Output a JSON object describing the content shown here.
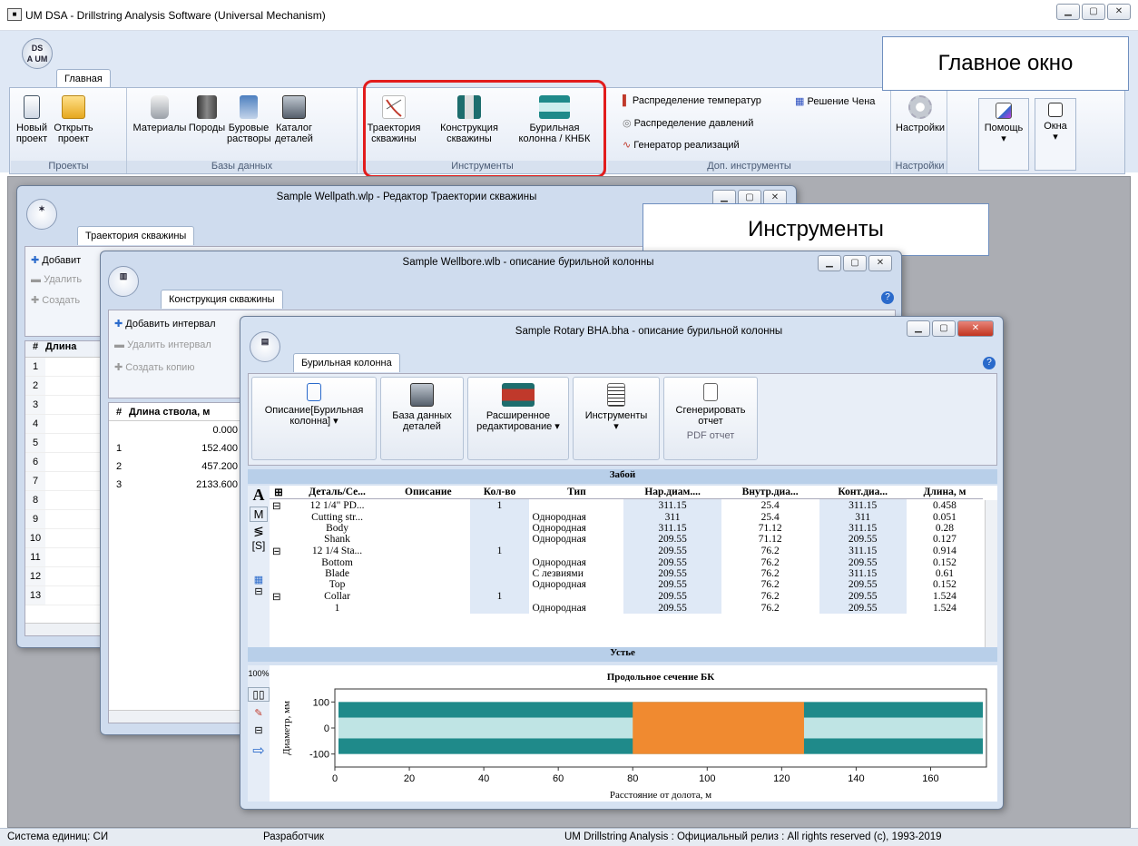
{
  "app": {
    "title": "UM DSA - Drillstring Analysis Software (Universal Mechanism)",
    "logo_text": "DS A UM"
  },
  "ribbon": {
    "tab": "Главная",
    "groups": {
      "projects": {
        "label": "Проекты",
        "new": "Новый проект",
        "open": "Открыть проект"
      },
      "databases": {
        "label": "Базы данных",
        "materials": "Материалы",
        "rocks": "Породы",
        "fluids": "Буровые растворы",
        "catalog": "Каталог деталей"
      },
      "tools": {
        "label": "Инструменты",
        "trajectory": "Траектория скважины",
        "construction": "Конструкция скважины",
        "string": "Бурильная колонна / КНБК"
      },
      "extra": {
        "label": "Доп. инструменты",
        "temp": "Распределение температур",
        "chen": "Решение Чена",
        "pressure": "Распределение давлений",
        "generator": "Генератор реализаций"
      },
      "settings": {
        "label": "Настройки",
        "btn": "Настройки"
      },
      "help": "Помощь",
      "windows": "Окна"
    }
  },
  "callouts": {
    "main": "Главное окно",
    "tools": "Инструменты"
  },
  "w1": {
    "title": "Sample Wellpath.wlp - Редактор Траектории скважины",
    "tab": "Траектория скважины",
    "add": "Добавит",
    "del": "Удалить",
    "create": "Создать",
    "col_num": "#",
    "col_len": "Длина",
    "rows": [
      "1",
      "2",
      "3",
      "4",
      "5",
      "6",
      "7",
      "8",
      "9",
      "10",
      "11",
      "12",
      "13"
    ]
  },
  "w2": {
    "title": "Sample Wellbore.wlb - описание бурильной колонны",
    "tab": "Конструкция скважины",
    "add": "Добавить интервал",
    "del": "Удалить интервал",
    "copy": "Создать копию",
    "col_num": "#",
    "col_len": "Длина ствола, м",
    "rows": [
      {
        "n": "",
        "v": "0.000"
      },
      {
        "n": "1",
        "v": "152.400"
      },
      {
        "n": "2",
        "v": "457.200"
      },
      {
        "n": "3",
        "v": "2133.600"
      }
    ]
  },
  "w3": {
    "title": "Sample Rotary BHA.bha - описание бурильной колонны",
    "tab": "Бурильная колонна",
    "buttons": {
      "desc": "Описание[Бурильная колонна]",
      "db": "База данных деталей",
      "adv": "Расширенное редактирование",
      "tools": "Инструменты",
      "gen": "Сгенерировать отчет",
      "pdf": "PDF отчет"
    },
    "bottom_label": "Забой",
    "top_label": "Устье",
    "side": {
      "a": "A",
      "m": "M",
      "s": "[S]"
    },
    "headers": [
      "Деталь/Се...",
      "Описание",
      "Кол-во",
      "Тип",
      "Нар.диам....",
      "Внутр.диа...",
      "Конт.диа...",
      "Длина, м"
    ],
    "rows": [
      [
        "12 1/4\" PD...",
        "",
        "1",
        "",
        "311.15",
        "25.4",
        "311.15",
        "0.458"
      ],
      [
        "Cutting str...",
        "",
        "",
        "Однородная",
        "311",
        "25.4",
        "311",
        "0.051"
      ],
      [
        "Body",
        "",
        "",
        "Однородная",
        "311.15",
        "71.12",
        "311.15",
        "0.28"
      ],
      [
        "Shank",
        "",
        "",
        "Однородная",
        "209.55",
        "71.12",
        "209.55",
        "0.127"
      ],
      [
        "12 1/4 Sta...",
        "",
        "1",
        "",
        "209.55",
        "76.2",
        "311.15",
        "0.914"
      ],
      [
        "Bottom",
        "",
        "",
        "Однородная",
        "209.55",
        "76.2",
        "209.55",
        "0.152"
      ],
      [
        "Blade",
        "",
        "",
        "С лезвиями",
        "209.55",
        "76.2",
        "311.15",
        "0.61"
      ],
      [
        "Top",
        "",
        "",
        "Однородная",
        "209.55",
        "76.2",
        "209.55",
        "0.152"
      ],
      [
        "Collar",
        "",
        "1",
        "",
        "209.55",
        "76.2",
        "209.55",
        "1.524"
      ],
      [
        "1",
        "",
        "",
        "Однородная",
        "209.55",
        "76.2",
        "209.55",
        "1.524"
      ]
    ],
    "chart_tools": {
      "zoom": "100%"
    }
  },
  "chart_data": {
    "type": "area",
    "title": "Продольное сечение БК",
    "xlabel": "Расстояние от долота, м",
    "ylabel": "Диаметр, мм",
    "xlim": [
      0,
      175
    ],
    "ylim": [
      -150,
      150
    ],
    "x_ticks": [
      0,
      20,
      40,
      60,
      80,
      100,
      120,
      140,
      160
    ],
    "y_ticks": [
      100,
      0,
      -100
    ],
    "highlight": {
      "from": 80,
      "to": 126,
      "color": "#f08a30"
    },
    "body_color": "#1f8a8a"
  },
  "status": {
    "units": "Система единиц: СИ",
    "mode": "Разработчик",
    "info": "UM Drillstring Analysis : Официальный релиз : All rights reserved (c), 1993-2019"
  }
}
